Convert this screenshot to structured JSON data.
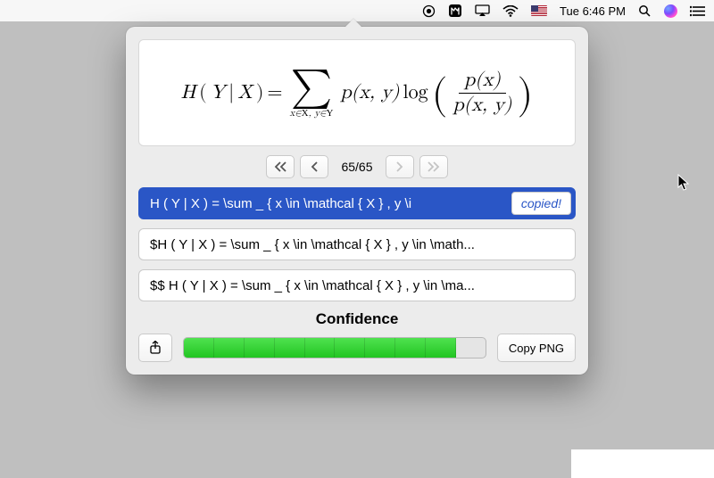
{
  "menubar": {
    "clock": "Tue 6:46 PM"
  },
  "equation": {
    "lhs_H": "H",
    "lp": "(",
    "Y": "Y",
    "bar": "|",
    "X": "X",
    "rp": ")",
    "eq": " = ",
    "sum_sub": "x∈𝒳, y∈𝒴",
    "pxy": "p(x, y)",
    "log": " log",
    "frac_num": "p(x)",
    "frac_den": "p(x, y)"
  },
  "pager": {
    "count": "65/65"
  },
  "results": {
    "r1": "H ( Y | X ) = \\sum _ { x \\in \\mathcal { X } , y \\i",
    "r1_badge": "copied!",
    "r2": "$H ( Y | X ) = \\sum _ { x \\in \\mathcal { X } , y \\in \\math...",
    "r3": "$$ H ( Y | X ) = \\sum _ { x \\in \\mathcal { X } , y \\in \\ma..."
  },
  "confidence": {
    "label": "Confidence",
    "filled": 9,
    "total": 10
  },
  "footer": {
    "copy_png": "Copy PNG"
  }
}
